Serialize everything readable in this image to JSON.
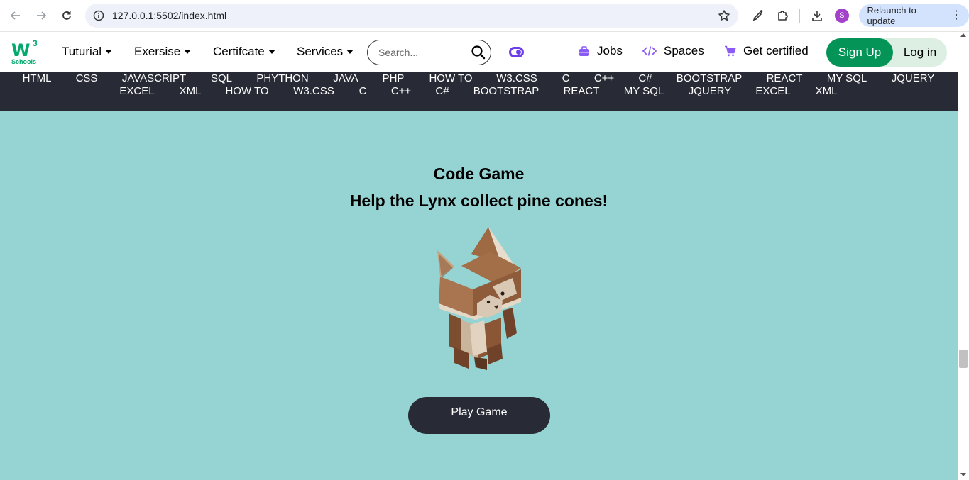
{
  "browser": {
    "url": "127.0.0.1:5502/index.html",
    "profile_initial": "S",
    "relaunch_label": "Relaunch to update",
    "icons": [
      "back-icon",
      "forward-icon",
      "reload-icon",
      "site-info-icon",
      "bookmark-star-icon",
      "eyedropper-icon",
      "extensions-icon",
      "download-icon",
      "menu-dots-icon"
    ]
  },
  "header": {
    "logo_main": "W",
    "logo_sup": "3",
    "logo_text": "Schools",
    "menu": [
      {
        "label": "Tuturial"
      },
      {
        "label": "Exersise"
      },
      {
        "label": "Certifcate"
      },
      {
        "label": "Services"
      }
    ],
    "search_placeholder": "Search...",
    "links": {
      "jobs": "Jobs",
      "spaces": "Spaces",
      "certified": "Get certified"
    },
    "signup_label": "Sign Up",
    "login_label": "Log in",
    "colors": {
      "brand_green": "#04aa6d",
      "signup_green": "#049458",
      "toggle_purple": "#6c3fe8",
      "icon_purple": "#8a5cf5"
    }
  },
  "topics": {
    "row1": [
      "HTML",
      "CSS",
      "JAVASCRIPT",
      "SQL",
      "PHYTHON",
      "JAVA",
      "PHP",
      "HOW TO",
      "W3.CSS",
      "C",
      "C++",
      "C#",
      "BOOTSTRAP",
      "REACT",
      "MY SQL",
      "JQUERY"
    ],
    "row2": [
      "EXCEL",
      "XML",
      "HOW TO",
      "W3.CSS",
      "C",
      "C++",
      "C#",
      "BOOTSTRAP",
      "REACT",
      "MY SQL",
      "JQUERY",
      "EXCEL",
      "XML"
    ]
  },
  "hero": {
    "title": "Code Game",
    "subtitle": "Help the Lynx collect pine cones!",
    "button_label": "Play Game",
    "colors": {
      "background": "#96d4d4",
      "button": "#282a35"
    }
  }
}
